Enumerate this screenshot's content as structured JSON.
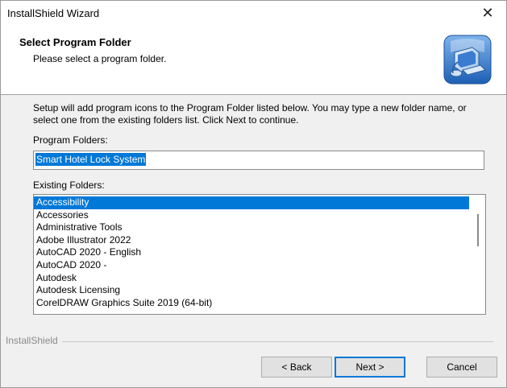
{
  "window": {
    "title": "InstallShield Wizard",
    "close_glyph": "✕"
  },
  "header": {
    "title": "Select Program Folder",
    "subtitle": "Please select a program folder.",
    "icon": "setup-computer-icon"
  },
  "body": {
    "intro": "Setup will add program icons to the Program Folder listed below.  You may type a new folder name, or select one from the existing folders list.  Click Next to continue.",
    "program_folders_label": "Program Folders:",
    "program_folder_value": "Smart Hotel Lock System",
    "existing_folders_label": "Existing Folders:",
    "existing_folders": [
      "Accessibility",
      "Accessories",
      "Administrative Tools",
      "Adobe Illustrator 2022",
      "AutoCAD 2020 - English",
      "AutoCAD 2020 -",
      "Autodesk",
      "Autodesk Licensing",
      "CorelDRAW Graphics Suite 2019 (64-bit)"
    ],
    "selected_index": 0
  },
  "footer": {
    "brand": "InstallShield",
    "buttons": {
      "back": "< Back",
      "next": "Next >",
      "cancel": "Cancel"
    }
  },
  "colors": {
    "selection": "#0078d7",
    "background": "#f0f0f0",
    "header_bg": "#ffffff"
  }
}
